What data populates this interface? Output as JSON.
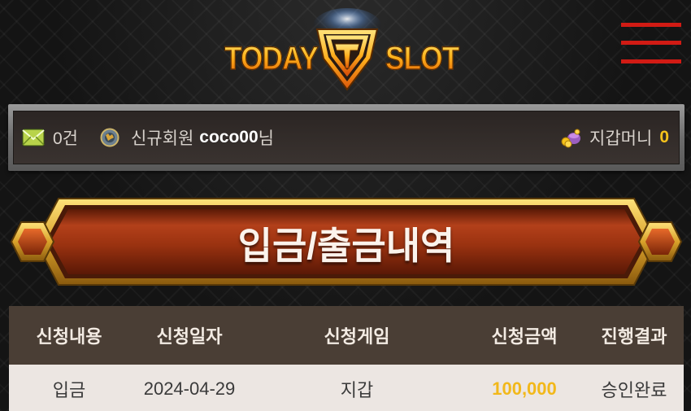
{
  "header": {
    "logo_left": "TODAY",
    "logo_right": "SLOT",
    "logo_badge": "T",
    "menu_icon": "hamburger-menu-icon"
  },
  "info_bar": {
    "messages_count": "0건",
    "member_grade": "신규회원",
    "username": "coco00",
    "username_suffix": "님",
    "wallet_label": "지갑머니",
    "wallet_amount": "0"
  },
  "banner": {
    "title": "입금/출금내역"
  },
  "table": {
    "columns": [
      "신청내용",
      "신청일자",
      "신청게임",
      "신청금액",
      "진행결과"
    ],
    "rows": [
      {
        "type": "입금",
        "date": "2024-04-29",
        "game": "지갑",
        "amount": "100,000",
        "result": "승인완료"
      }
    ]
  },
  "colors": {
    "accent_red": "#d11b14",
    "amount_gold": "#f2b81a",
    "banner_red": "#8a2a0c",
    "banner_gold": "#f1c232"
  }
}
